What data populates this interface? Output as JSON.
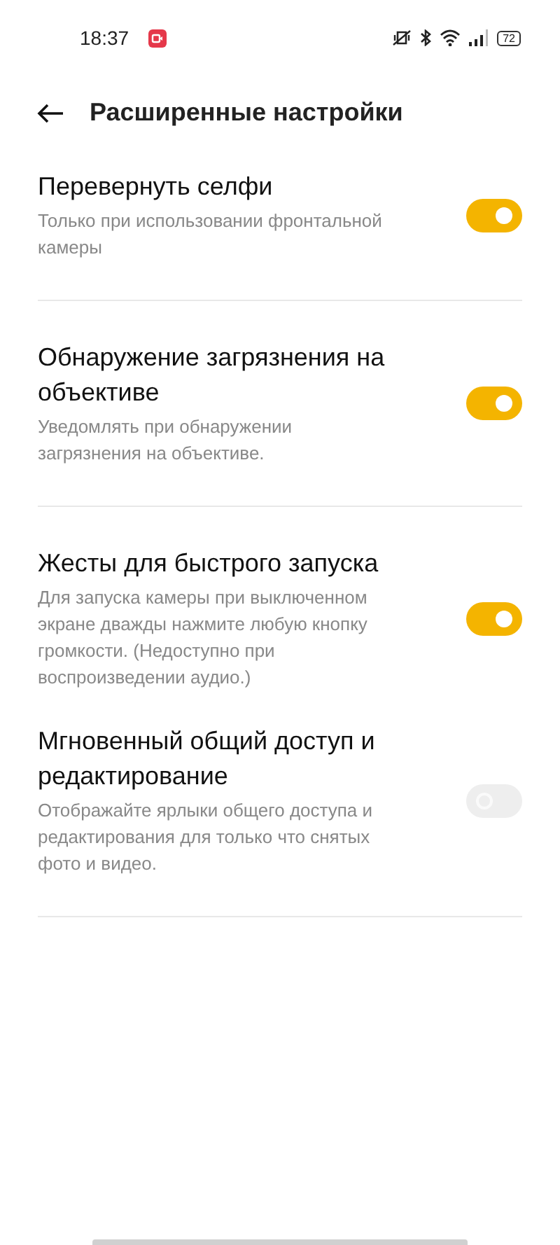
{
  "status_bar": {
    "time": "18:37",
    "battery": "72"
  },
  "header": {
    "title": "Расширенные настройки"
  },
  "settings": [
    {
      "title": "Перевернуть селфи",
      "description": "Только при использовании фронтальной камеры",
      "on": true,
      "disabled": false,
      "divider": true
    },
    {
      "title": "Обнаружение загрязнения на объективе",
      "description": "Уведомлять при обнаружении загрязнения на объективе.",
      "on": true,
      "disabled": false,
      "divider": true
    },
    {
      "title": "Жесты для быстрого запуска",
      "description": "Для запуска камеры при выключенном экране дважды нажмите любую кнопку громкости. (Недоступно при воспроизведении аудио.)",
      "on": true,
      "disabled": false,
      "divider": false
    },
    {
      "title": "Мгновенный общий доступ и редактирование",
      "description": "Отображайте ярлыки общего доступа и редактирования для только что снятых фото и видео.",
      "on": false,
      "disabled": true,
      "divider": true
    }
  ]
}
